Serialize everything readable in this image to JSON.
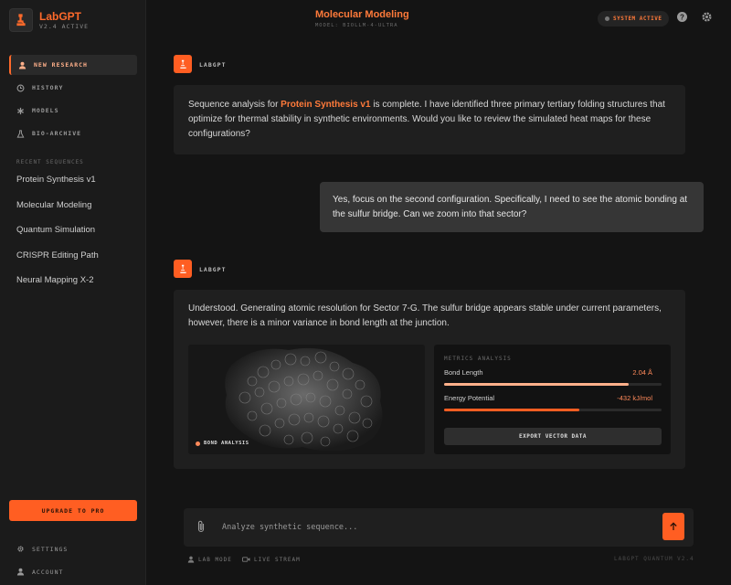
{
  "brand": {
    "title": "LabGPT",
    "version": "V2.4 ACTIVE"
  },
  "nav": [
    {
      "label": "NEW RESEARCH",
      "icon": "user-icon",
      "active": true
    },
    {
      "label": "HISTORY",
      "icon": "history-icon",
      "active": false
    },
    {
      "label": "MODELS",
      "icon": "asterisk-icon",
      "active": false
    },
    {
      "label": "BIO-ARCHIVE",
      "icon": "flask-icon",
      "active": false
    }
  ],
  "recent": {
    "heading": "RECENT SEQUENCES",
    "items": [
      "Protein Synthesis v1",
      "Molecular Modeling",
      "Quantum Simulation",
      "CRISPR Editing Path",
      "Neural Mapping X-2"
    ]
  },
  "sidebar_bottom": {
    "upgrade": "UPGRADE TO PRO",
    "settings": "SETTINGS",
    "account": "ACCOUNT"
  },
  "header": {
    "title": "Molecular Modeling",
    "model": "MODEL: BIOLLM-4-ULTRA",
    "status": "SYSTEM ACTIVE"
  },
  "messages": {
    "first": {
      "sender": "LABGPT",
      "pre": "Sequence analysis for ",
      "highlight": "Protein Synthesis v1",
      "post": " is complete. I have identified three primary tertiary folding structures that optimize for thermal stability in synthetic environments. Would you like to review the simulated heat maps for these configurations?"
    },
    "user": {
      "text": "Yes, focus on the second configuration. Specifically, I need to see the atomic bonding at the sulfur bridge. Can we zoom into that sector?"
    },
    "second": {
      "sender": "LABGPT",
      "text": "Understood. Generating atomic resolution for Sector 7-G. The sulfur bridge appears stable under current parameters, however, there is a minor variance in bond length at the junction."
    }
  },
  "visualization": {
    "label": "BOND ANALYSIS"
  },
  "metrics": {
    "heading": "METRICS ANALYSIS",
    "rows": [
      {
        "name": "Bond Length",
        "value": "2.04 Å",
        "fill": 0.85,
        "color": "#ffb08a"
      },
      {
        "name": "Energy Potential",
        "value": "-432 kJ/mol",
        "fill": 0.62,
        "color": "#ff5e22"
      }
    ],
    "export": "EXPORT VECTOR DATA"
  },
  "composer": {
    "placeholder": "Analyze synthetic sequence..."
  },
  "footer": {
    "lab_mode": "LAB MODE",
    "live_stream": "LIVE STREAM",
    "version": "LABGPT QUANTUM V2.4"
  },
  "colors": {
    "accent": "#ff5e22",
    "accent_text": "#ff7a3a",
    "background": "#141414",
    "sidebar": "#1b1b1b"
  }
}
